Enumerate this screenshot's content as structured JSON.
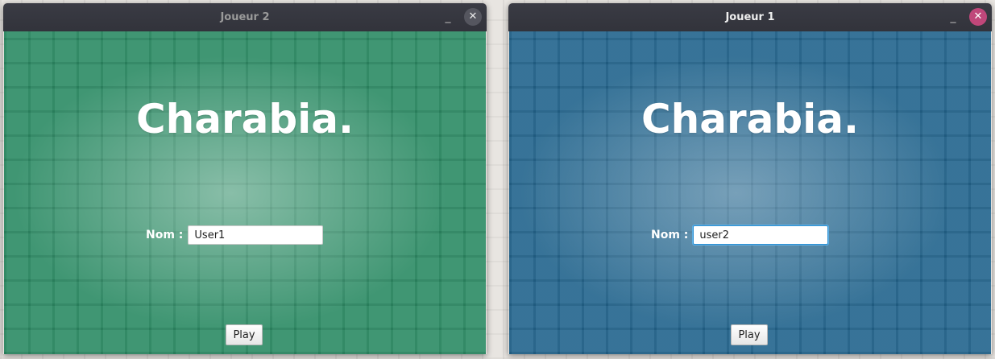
{
  "windows": [
    {
      "title": "Joueur 2",
      "heading": "Charabia.",
      "name_label": "Nom :",
      "name_value": "User1",
      "play_label": "Play",
      "minimize_icon": "_",
      "close_icon": "✕",
      "accent": "#2e8c66"
    },
    {
      "title": "Joueur 1",
      "heading": "Charabia.",
      "name_label": "Nom :",
      "name_value": "user2",
      "play_label": "Play",
      "minimize_icon": "_",
      "close_icon": "✕",
      "accent": "#24668e"
    }
  ]
}
